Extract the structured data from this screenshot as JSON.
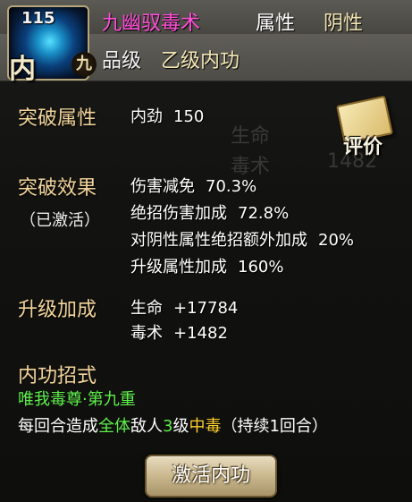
{
  "header": {
    "level": "115",
    "tag_main": "内",
    "tag_rank": "九",
    "skill_name": "九幽驭毒术",
    "attr_label": "属性",
    "attr_value": "阴性",
    "grade_label": "品级",
    "grade_value": "乙级内功"
  },
  "breakthrough_attr": {
    "title": "突破属性",
    "stat": "内劲",
    "value": "150"
  },
  "review_button": {
    "label": "评价"
  },
  "breakthrough_effect": {
    "title": "突破效果",
    "status": "（已激活）",
    "items": [
      {
        "label": "伤害减免",
        "value": "70.3%"
      },
      {
        "label": "绝招伤害加成",
        "value": "72.8%"
      },
      {
        "label": "对阴性属性绝招额外加成",
        "value": "20%"
      },
      {
        "label": "升级属性加成",
        "value": "160%"
      }
    ]
  },
  "upgrade_bonus": {
    "title": "升级加成",
    "items": [
      {
        "label": "生命",
        "value": "+17784"
      },
      {
        "label": "毒术",
        "value": "+1482"
      }
    ]
  },
  "background_ghost": {
    "hp_label": "生命",
    "poison_label": "毒术",
    "poison_value": "1482"
  },
  "technique": {
    "title": "内功招式",
    "name": "唯我毒尊·第九重",
    "desc_1": "每回合造成",
    "desc_target": "全体",
    "desc_2": "敌人",
    "desc_level": "3",
    "desc_3": "级",
    "desc_status": "中毒",
    "desc_4": "（持续1回合）"
  },
  "activate_button": {
    "label": "激活内功"
  },
  "colors": {
    "name_color": "#ff4fd8",
    "section_color": "#f2d49a",
    "green": "#5ef04a",
    "yellow": "#ffd02e"
  },
  "icons": [
    "skill-orb-icon",
    "book-icon"
  ]
}
